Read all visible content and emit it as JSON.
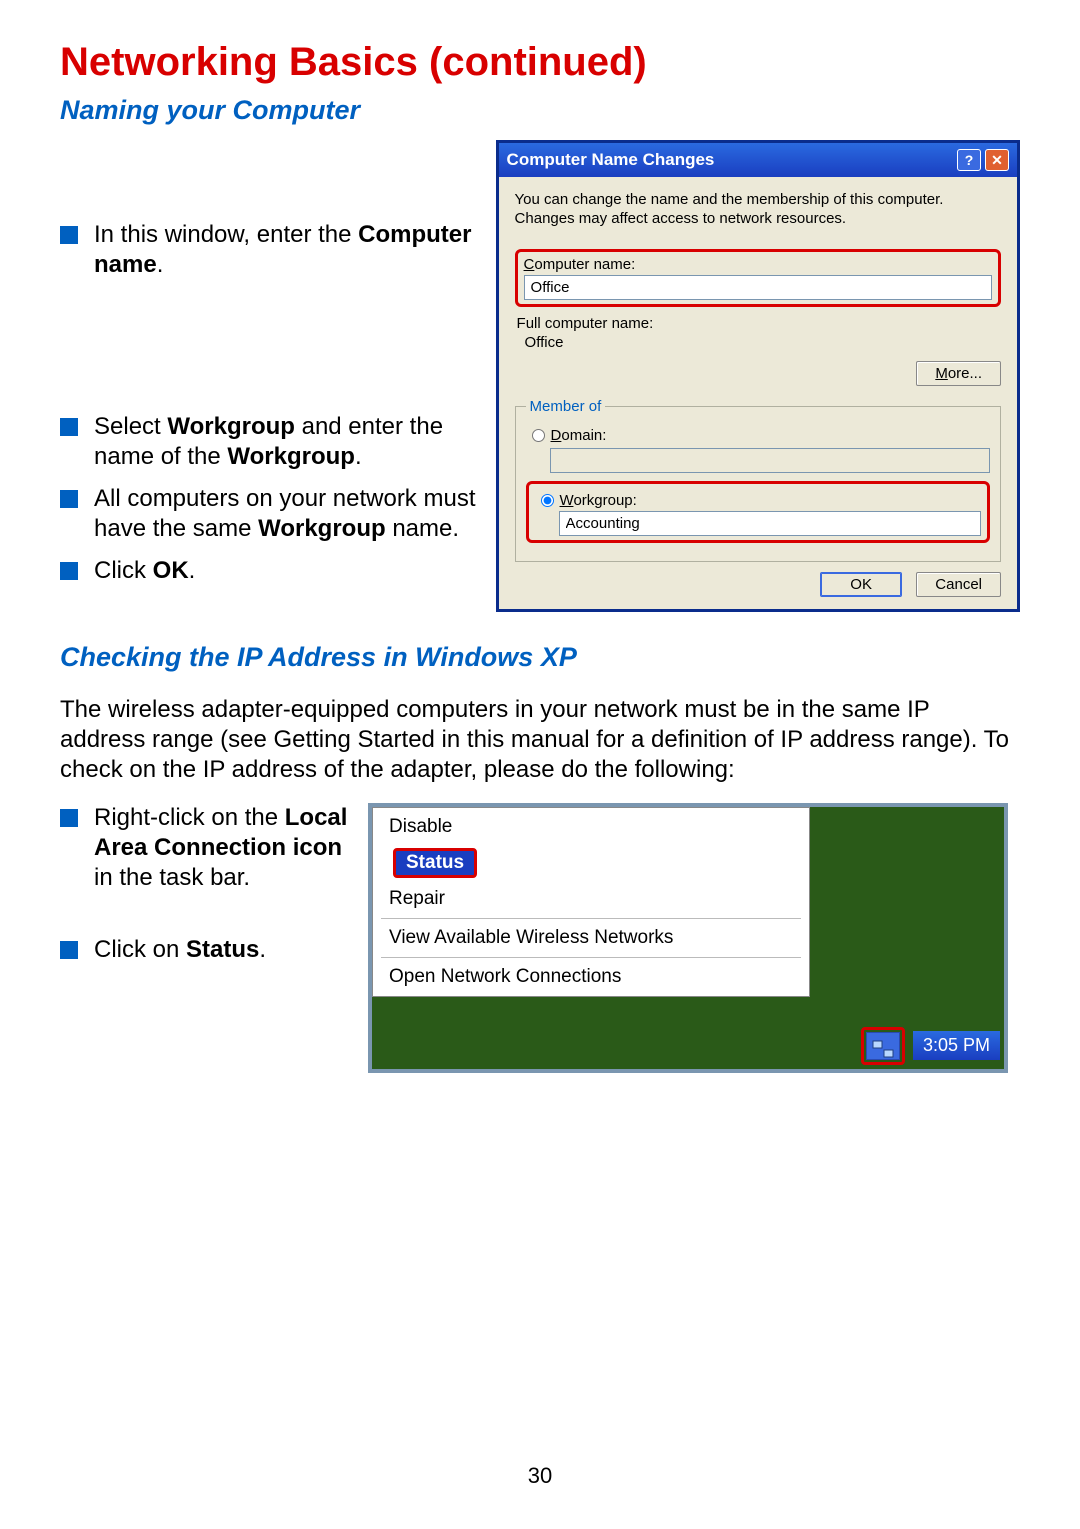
{
  "page": {
    "title": "Networking Basics (continued)",
    "subtitle1": "Naming your Computer",
    "subtitle2": "Checking the IP Address in Windows XP",
    "number": "30"
  },
  "instructions1": {
    "item1_a": "In this window, enter the ",
    "item1_b": "Computer name",
    "item1_c": ".",
    "item2_a": "Select ",
    "item2_b": "Workgroup",
    "item2_c": " and enter the name of the ",
    "item2_d": "Workgroup",
    "item2_e": ".",
    "item3_a": "All computers on your network must have the same ",
    "item3_b": "Workgroup",
    "item3_c": " name.",
    "item4_a": "Click ",
    "item4_b": "OK",
    "item4_c": "."
  },
  "dialog": {
    "title": "Computer Name Changes",
    "desc": "You can change the name and the membership of this computer. Changes may affect access to network resources.",
    "computer_name_label_a": "C",
    "computer_name_label_b": "omputer name:",
    "computer_name_value": "Office",
    "full_label": "Full computer name:",
    "full_value": "Office",
    "more_btn_a": "M",
    "more_btn_b": "ore...",
    "member_legend": "Member of",
    "domain_label_a": "D",
    "domain_label_b": "omain:",
    "workgroup_label_a": "W",
    "workgroup_label_b": "orkgroup:",
    "workgroup_value": "Accounting",
    "ok": "OK",
    "cancel": "Cancel"
  },
  "section2": {
    "paragraph": "The wireless adapter-equipped computers in your network must be in the same IP address range (see Getting Started in this manual for a definition of IP address range). To check on the IP address of the adapter, please do the following:",
    "item1_a": "Right-click on the ",
    "item1_b": "Local Area Connection icon",
    "item1_c": " in the task bar.",
    "item2_a": "Click on ",
    "item2_b": "Status",
    "item2_c": "."
  },
  "menu": {
    "disable": "Disable",
    "status": "Status",
    "repair": "Repair",
    "view": "View Available Wireless Networks",
    "open": "Open Network Connections",
    "clock": "3:05 PM"
  }
}
